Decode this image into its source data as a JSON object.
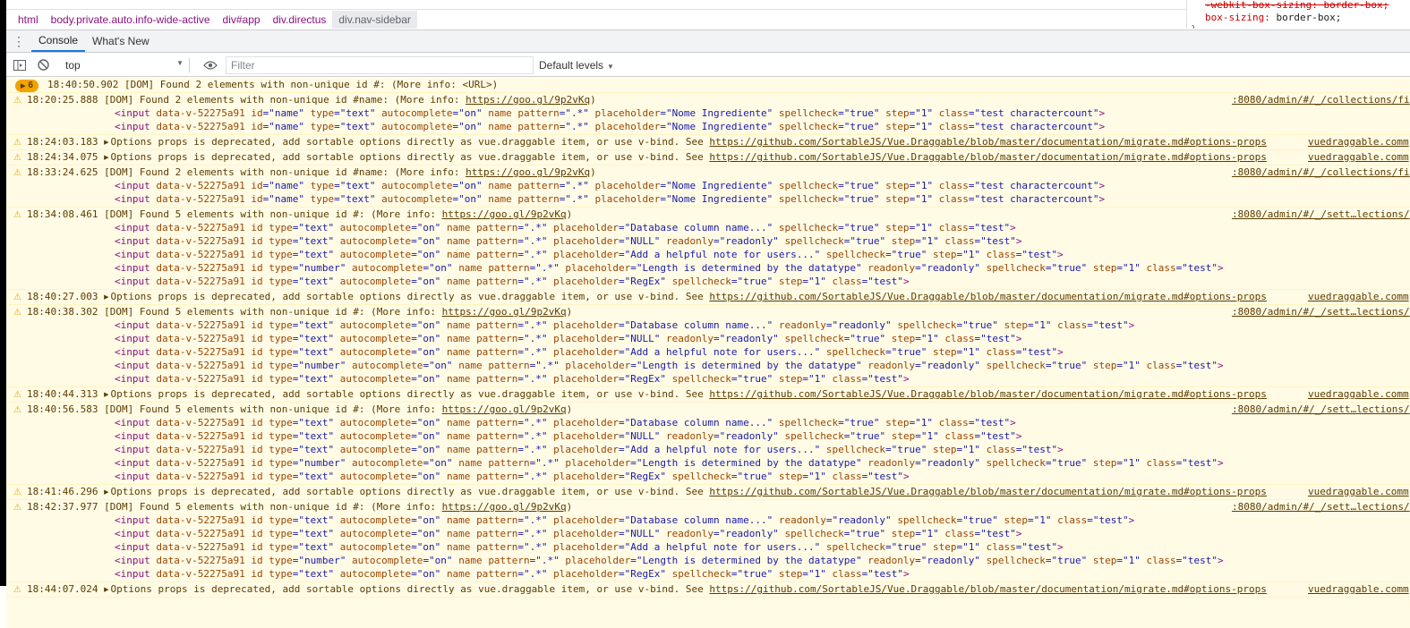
{
  "breadcrumbs": [
    "html",
    "body.private.auto.info-wide-active",
    "div#app",
    "div.directus",
    "div.nav-sidebar"
  ],
  "styles_peek": {
    "line1": "-webkit-box-sizing: border-box;",
    "line2_prop": "box-sizing",
    "line2_val": "border-box;",
    "line3": "}"
  },
  "drawer": {
    "tabs": [
      "Console",
      "What's New"
    ]
  },
  "toolbar": {
    "context": "top",
    "filter_placeholder": "Filter",
    "levels": "Default levels"
  },
  "console": {
    "badge_count": "6",
    "rows": [
      {
        "kind": "badge",
        "time": "18:40:50.902",
        "text": "[DOM] Found 2 elements with non-unique id #: (More info: <URL>)"
      },
      {
        "kind": "dom",
        "time": "18:20:25.888",
        "text": "[DOM] Found 2 elements with non-unique id #name: (More info: ",
        "link": "https://goo.gl/9p2vKq",
        "tail": ")",
        "src": ":8080/admin/#/_/collections/fi",
        "lines": [
          "<input data-v-52275a91 id=\"name\" type=\"text\" autocomplete=\"on\" name pattern=\".*\" placeholder=\"Nome Ingrediente\" spellcheck=\"true\" step=\"1\" class=\"test charactercount\">",
          "<input data-v-52275a91 id=\"name\" type=\"text\" autocomplete=\"on\" name pattern=\".*\" placeholder=\"Nome Ingrediente\" spellcheck=\"true\" step=\"1\" class=\"test charactercount\">"
        ]
      },
      {
        "kind": "vd",
        "time": "18:24:03.183",
        "text": "Options props is deprecated, add sortable options directly as vue.draggable item, or use v-bind. See ",
        "link": "https://github.com/SortableJS/Vue.Draggable/blob/master/documentation/migrate.md#options-props",
        "src": "vuedraggable.comm"
      },
      {
        "kind": "vd",
        "time": "18:24:34.075",
        "text": "Options props is deprecated, add sortable options directly as vue.draggable item, or use v-bind. See ",
        "link": "https://github.com/SortableJS/Vue.Draggable/blob/master/documentation/migrate.md#options-props",
        "src": "vuedraggable.comm"
      },
      {
        "kind": "dom",
        "time": "18:33:24.625",
        "text": "[DOM] Found 2 elements with non-unique id #name: (More info: ",
        "link": "https://goo.gl/9p2vKq",
        "tail": ")",
        "src": ":8080/admin/#/_/collections/fi",
        "lines": [
          "<input data-v-52275a91 id=\"name\" type=\"text\" autocomplete=\"on\" name pattern=\".*\" placeholder=\"Nome Ingrediente\" spellcheck=\"true\" step=\"1\" class=\"test charactercount\">",
          "<input data-v-52275a91 id=\"name\" type=\"text\" autocomplete=\"on\" name pattern=\".*\" placeholder=\"Nome Ingrediente\" spellcheck=\"true\" step=\"1\" class=\"test charactercount\">"
        ]
      },
      {
        "kind": "dom",
        "time": "18:34:08.461",
        "text": "[DOM] Found 5 elements with non-unique id #: (More info: ",
        "link": "https://goo.gl/9p2vKq",
        "tail": ")",
        "src": ":8080/admin/#/_/sett…lections/",
        "lines": [
          "<input data-v-52275a91 id type=\"text\" autocomplete=\"on\" name pattern=\".*\" placeholder=\"Database column name...\" spellcheck=\"true\" step=\"1\" class=\"test\">",
          "<input data-v-52275a91 id type=\"text\" autocomplete=\"on\" name pattern=\".*\" placeholder=\"NULL\" readonly=\"readonly\" spellcheck=\"true\" step=\"1\" class=\"test\">",
          "<input data-v-52275a91 id type=\"text\" autocomplete=\"on\" name pattern=\".*\" placeholder=\"Add a helpful note for users...\" spellcheck=\"true\" step=\"1\" class=\"test\">",
          "<input data-v-52275a91 id type=\"number\" autocomplete=\"on\" name pattern=\".*\" placeholder=\"Length is determined by the datatype\" readonly=\"readonly\" spellcheck=\"true\" step=\"1\" class=\"test\">",
          "<input data-v-52275a91 id type=\"text\" autocomplete=\"on\" name pattern=\".*\" placeholder=\"RegEx\" spellcheck=\"true\" step=\"1\" class=\"test\">"
        ]
      },
      {
        "kind": "vd",
        "time": "18:40:27.003",
        "text": "Options props is deprecated, add sortable options directly as vue.draggable item, or use v-bind. See ",
        "link": "https://github.com/SortableJS/Vue.Draggable/blob/master/documentation/migrate.md#options-props",
        "src": "vuedraggable.comm"
      },
      {
        "kind": "dom",
        "time": "18:40:38.302",
        "text": "[DOM] Found 5 elements with non-unique id #: (More info: ",
        "link": "https://goo.gl/9p2vKq",
        "tail": ")",
        "src": ":8080/admin/#/_/sett…lections/",
        "lines": [
          "<input data-v-52275a91 id type=\"text\" autocomplete=\"on\" name pattern=\".*\" placeholder=\"Database column name...\" readonly=\"readonly\" spellcheck=\"true\" step=\"1\" class=\"test\">",
          "<input data-v-52275a91 id type=\"text\" autocomplete=\"on\" name pattern=\".*\" placeholder=\"NULL\" readonly=\"readonly\" spellcheck=\"true\" step=\"1\" class=\"test\">",
          "<input data-v-52275a91 id type=\"text\" autocomplete=\"on\" name pattern=\".*\" placeholder=\"Add a helpful note for users...\" spellcheck=\"true\" step=\"1\" class=\"test\">",
          "<input data-v-52275a91 id type=\"number\" autocomplete=\"on\" name pattern=\".*\" placeholder=\"Length is determined by the datatype\" readonly=\"readonly\" spellcheck=\"true\" step=\"1\" class=\"test\">",
          "<input data-v-52275a91 id type=\"text\" autocomplete=\"on\" name pattern=\".*\" placeholder=\"RegEx\" spellcheck=\"true\" step=\"1\" class=\"test\">"
        ]
      },
      {
        "kind": "vd",
        "time": "18:40:44.313",
        "text": "Options props is deprecated, add sortable options directly as vue.draggable item, or use v-bind. See ",
        "link": "https://github.com/SortableJS/Vue.Draggable/blob/master/documentation/migrate.md#options-props",
        "src": "vuedraggable.comm"
      },
      {
        "kind": "dom",
        "time": "18:40:56.583",
        "text": "[DOM] Found 5 elements with non-unique id #: (More info: ",
        "link": "https://goo.gl/9p2vKq",
        "tail": ")",
        "src": ":8080/admin/#/_/sett…lections/",
        "lines": [
          "<input data-v-52275a91 id type=\"text\" autocomplete=\"on\" name pattern=\".*\" placeholder=\"Database column name...\" spellcheck=\"true\" step=\"1\" class=\"test\">",
          "<input data-v-52275a91 id type=\"text\" autocomplete=\"on\" name pattern=\".*\" placeholder=\"NULL\" readonly=\"readonly\" spellcheck=\"true\" step=\"1\" class=\"test\">",
          "<input data-v-52275a91 id type=\"text\" autocomplete=\"on\" name pattern=\".*\" placeholder=\"Add a helpful note for users...\" spellcheck=\"true\" step=\"1\" class=\"test\">",
          "<input data-v-52275a91 id type=\"number\" autocomplete=\"on\" name pattern=\".*\" placeholder=\"Length is determined by the datatype\" readonly=\"readonly\" spellcheck=\"true\" step=\"1\" class=\"test\">",
          "<input data-v-52275a91 id type=\"text\" autocomplete=\"on\" name pattern=\".*\" placeholder=\"RegEx\" spellcheck=\"true\" step=\"1\" class=\"test\">"
        ]
      },
      {
        "kind": "vd",
        "time": "18:41:46.296",
        "text": "Options props is deprecated, add sortable options directly as vue.draggable item, or use v-bind. See ",
        "link": "https://github.com/SortableJS/Vue.Draggable/blob/master/documentation/migrate.md#options-props",
        "src": "vuedraggable.comm"
      },
      {
        "kind": "dom",
        "time": "18:42:37.977",
        "text": "[DOM] Found 5 elements with non-unique id #: (More info: ",
        "link": "https://goo.gl/9p2vKq",
        "tail": ")",
        "src": ":8080/admin/#/_/sett…lections/",
        "lines": [
          "<input data-v-52275a91 id type=\"text\" autocomplete=\"on\" name pattern=\".*\" placeholder=\"Database column name...\" readonly=\"readonly\" spellcheck=\"true\" step=\"1\" class=\"test\">",
          "<input data-v-52275a91 id type=\"text\" autocomplete=\"on\" name pattern=\".*\" placeholder=\"NULL\" readonly=\"readonly\" spellcheck=\"true\" step=\"1\" class=\"test\">",
          "<input data-v-52275a91 id type=\"text\" autocomplete=\"on\" name pattern=\".*\" placeholder=\"Add a helpful note for users...\" spellcheck=\"true\" step=\"1\" class=\"test\">",
          "<input data-v-52275a91 id type=\"number\" autocomplete=\"on\" name pattern=\".*\" placeholder=\"Length is determined by the datatype\" readonly=\"readonly\" spellcheck=\"true\" step=\"1\" class=\"test\">",
          "<input data-v-52275a91 id type=\"text\" autocomplete=\"on\" name pattern=\".*\" placeholder=\"RegEx\" spellcheck=\"true\" step=\"1\" class=\"test\">"
        ]
      },
      {
        "kind": "vd",
        "time": "18:44:07.024",
        "text": "Options props is deprecated, add sortable options directly as vue.draggable item, or use v-bind. See ",
        "link": "https://github.com/SortableJS/Vue.Draggable/blob/master/documentation/migrate.md#options-props",
        "src": "vuedraggable.comm"
      }
    ]
  },
  "colors": {
    "warning_bg": "#fffbe5",
    "warning_text": "#5c3c00",
    "warning_icon": "#e8a600",
    "tab_accent": "#1a73e8"
  }
}
